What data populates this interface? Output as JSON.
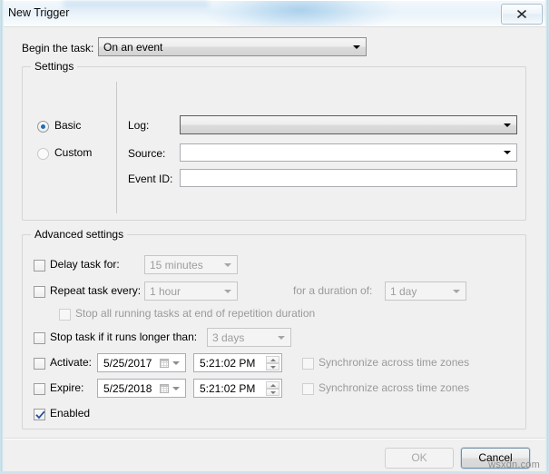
{
  "window": {
    "title": "New Trigger",
    "close_icon": "close-icon"
  },
  "begin_task": {
    "label": "Begin the task:",
    "value": "On an event"
  },
  "settings": {
    "group_label": "Settings",
    "mode": {
      "basic_label": "Basic",
      "custom_label": "Custom",
      "selected": "Basic"
    },
    "fields": [
      {
        "label": "Log:",
        "value": "",
        "type": "combo-button"
      },
      {
        "label": "Source:",
        "value": "",
        "type": "combo"
      },
      {
        "label": "Event ID:",
        "value": "",
        "type": "text"
      }
    ]
  },
  "advanced": {
    "group_label": "Advanced settings",
    "delay": {
      "label": "Delay task for:",
      "checked": false,
      "value": "15 minutes"
    },
    "repeat": {
      "label": "Repeat task every:",
      "checked": false,
      "value": "1 hour",
      "duration_label": "for a duration of:",
      "duration_value": "1 day"
    },
    "stop_repetition": {
      "label": "Stop all running tasks at end of repetition duration",
      "checked": false
    },
    "stop_longer": {
      "label": "Stop task if it runs longer than:",
      "checked": false,
      "value": "3 days"
    },
    "activate": {
      "label": "Activate:",
      "checked": false,
      "date": "5/25/2017",
      "time": "5:21:02 PM",
      "sync_label": "Synchronize across time zones",
      "sync_checked": false
    },
    "expire": {
      "label": "Expire:",
      "checked": false,
      "date": "5/25/2018",
      "time": "5:21:02 PM",
      "sync_label": "Synchronize across time zones",
      "sync_checked": false
    },
    "enabled": {
      "label": "Enabled",
      "checked": true
    }
  },
  "footer": {
    "ok_label": "OK",
    "cancel_label": "Cancel"
  },
  "watermark": "wsxdn.com"
}
